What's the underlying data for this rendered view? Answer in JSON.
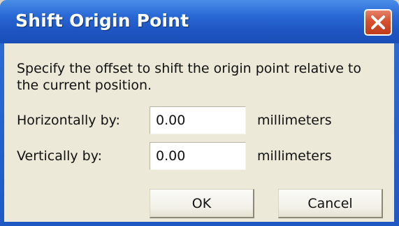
{
  "dialog": {
    "title": "Shift Origin Point",
    "close_icon": "close-icon",
    "description": "Specify the offset to shift the origin point relative to the current position."
  },
  "fields": {
    "horizontal": {
      "label": "Horizontally by:",
      "value": "0.00",
      "unit": "millimeters"
    },
    "vertical": {
      "label": "Vertically by:",
      "value": "0.00",
      "unit": "millimeters"
    }
  },
  "buttons": {
    "ok_label": "OK",
    "cancel_label": "Cancel"
  },
  "colors": {
    "titlebar": "#2a6ad6",
    "close_button": "#d4512f",
    "client_background": "#ece9d8"
  }
}
